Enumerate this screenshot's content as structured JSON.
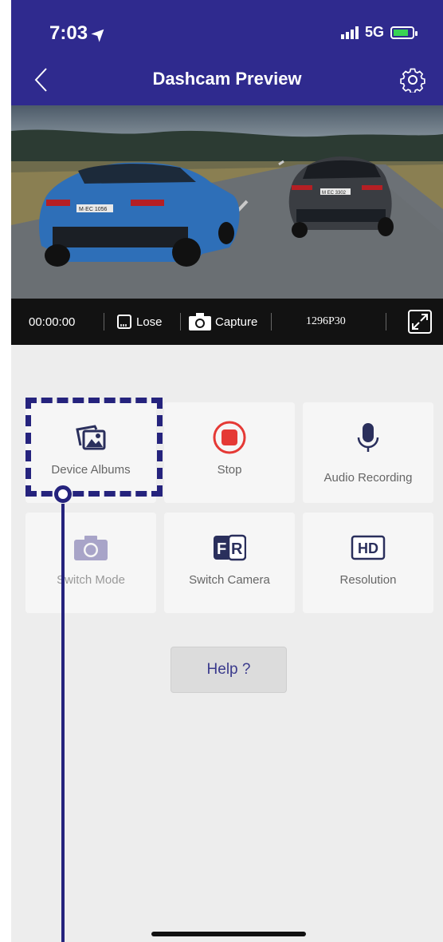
{
  "status_bar": {
    "time": "7:03",
    "network": "5G"
  },
  "header": {
    "title": "Dashcam Preview"
  },
  "video_bar": {
    "timestamp": "00:00:00",
    "lose_label": "Lose",
    "capture_label": "Capture",
    "resolution": "1296P30"
  },
  "video": {
    "plate_left": "M·EC 1056",
    "plate_right": "M EC 3302"
  },
  "actions": [
    {
      "label": "Device Albums",
      "icon": "photo-albums-icon"
    },
    {
      "label": "Stop",
      "icon": "stop-record-icon"
    },
    {
      "label": "Audio Recording",
      "icon": "microphone-icon"
    },
    {
      "label": "Switch Mode",
      "icon": "camera-icon"
    },
    {
      "label": "Switch Camera",
      "icon": "front-rear-icon"
    },
    {
      "label": "Resolution",
      "icon": "hd-icon"
    }
  ],
  "icon_text": {
    "front": "F",
    "rear": "R",
    "hd": "HD"
  },
  "help": {
    "label": "Help ?"
  },
  "colors": {
    "header": "#2f2a8e",
    "stop": "#e53935",
    "accent": "#25237d",
    "video_bar": "#121212"
  }
}
